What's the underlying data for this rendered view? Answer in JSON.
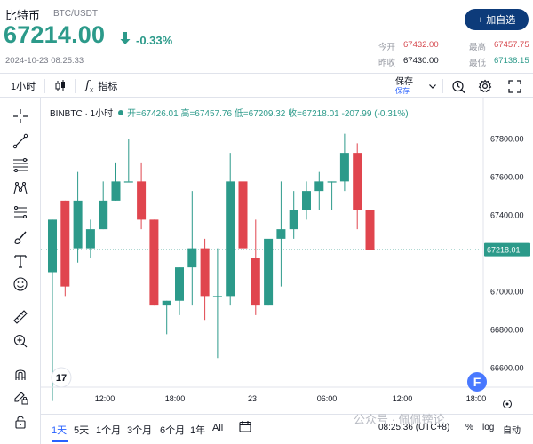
{
  "header": {
    "name": "比特币",
    "pair": "BTC/USDT",
    "price": "67214.00",
    "change": "-0.33%",
    "timestamp": "2024-10-23 08:25:33",
    "add_button": "+ 加自选",
    "stats": {
      "open_label": "今开",
      "open": "67432.00",
      "prev_label": "昨收",
      "prev": "67430.00",
      "high_label": "最高",
      "high": "67457.75",
      "low_label": "最低",
      "low": "67138.15"
    }
  },
  "toolbar": {
    "interval": "1小时",
    "indicators": "指标",
    "save_top": "保存",
    "save_bottom": "保存",
    "icons": [
      "candles-icon",
      "fx-icon",
      "chevron-down-icon",
      "replay-icon",
      "gear-icon",
      "fullscreen-icon"
    ]
  },
  "left_tools": [
    "crosshair-icon",
    "trendline-icon",
    "fib-icon",
    "pattern-icon",
    "measure-icon",
    "brush-icon",
    "text-icon",
    "emoji-icon",
    "ruler-icon",
    "zoom-in-icon",
    "magnet-icon",
    "pencil-lock-icon",
    "lock-icon"
  ],
  "legend": {
    "symbol": "BINBTC · 1小时",
    "open": "开=67426.01",
    "high": "高=67457.76",
    "low": "低=67209.32",
    "close": "收=67218.01",
    "change": "-207.99 (-0.31%)"
  },
  "chart_data": {
    "type": "candlestick",
    "y_ticks": [
      "67800.00",
      "67600.00",
      "67400.00",
      "67200.00",
      "67000.00",
      "66800.00",
      "66600.00"
    ],
    "x_ticks": [
      "12:00",
      "18:00",
      "23",
      "06:00",
      "12:00",
      "18:00"
    ],
    "current_price_label": "67218.01",
    "colors": {
      "up": "#2c9a8a",
      "down": "#e0454e"
    },
    "candles": [
      {
        "o": 67100,
        "h": 67375,
        "l": 66425,
        "c": 67375
      },
      {
        "o": 67475,
        "h": 67475,
        "l": 66975,
        "c": 67025
      },
      {
        "o": 67225,
        "h": 67625,
        "l": 67150,
        "c": 67475
      },
      {
        "o": 67225,
        "h": 67375,
        "l": 67175,
        "c": 67325
      },
      {
        "o": 67325,
        "h": 67575,
        "l": 67325,
        "c": 67475
      },
      {
        "o": 67475,
        "h": 67675,
        "l": 67475,
        "c": 67575
      },
      {
        "o": 67575,
        "h": 67800,
        "l": 67575,
        "c": 67575
      },
      {
        "o": 67575,
        "h": 67675,
        "l": 67325,
        "c": 67375
      },
      {
        "o": 67375,
        "h": 67375,
        "l": 66925,
        "c": 66925
      },
      {
        "o": 66925,
        "h": 66950,
        "l": 66775,
        "c": 66950
      },
      {
        "o": 66950,
        "h": 67125,
        "l": 66875,
        "c": 67125
      },
      {
        "o": 67125,
        "h": 67525,
        "l": 66925,
        "c": 67225
      },
      {
        "o": 67225,
        "h": 67275,
        "l": 66850,
        "c": 66975
      },
      {
        "o": 66975,
        "h": 67225,
        "l": 66650,
        "c": 66975
      },
      {
        "o": 66975,
        "h": 67725,
        "l": 66925,
        "c": 67575
      },
      {
        "o": 67575,
        "h": 67775,
        "l": 67075,
        "c": 67225
      },
      {
        "o": 67175,
        "h": 67375,
        "l": 66875,
        "c": 66925
      },
      {
        "o": 66925,
        "h": 67225,
        "l": 66925,
        "c": 67275
      },
      {
        "o": 67275,
        "h": 67575,
        "l": 67025,
        "c": 67325
      },
      {
        "o": 67325,
        "h": 67525,
        "l": 67275,
        "c": 67425
      },
      {
        "o": 67425,
        "h": 67575,
        "l": 67375,
        "c": 67525
      },
      {
        "o": 67525,
        "h": 67625,
        "l": 67425,
        "c": 67575
      },
      {
        "o": 67575,
        "h": 67575,
        "l": 67425,
        "c": 67575
      },
      {
        "o": 67575,
        "h": 67825,
        "l": 67525,
        "c": 67725
      },
      {
        "o": 67725,
        "h": 67775,
        "l": 67325,
        "c": 67425
      },
      {
        "o": 67425,
        "h": 67425,
        "l": 67218,
        "c": 67218
      }
    ]
  },
  "bottom": {
    "ranges": [
      "1天",
      "5天",
      "1个月",
      "3个月",
      "6个月",
      "1年",
      "All"
    ],
    "time": "08:25:36 (UTC+8)",
    "percent": "%",
    "log": "log",
    "auto": "自动"
  },
  "watermark": "公众号 · 佩佩镑论"
}
